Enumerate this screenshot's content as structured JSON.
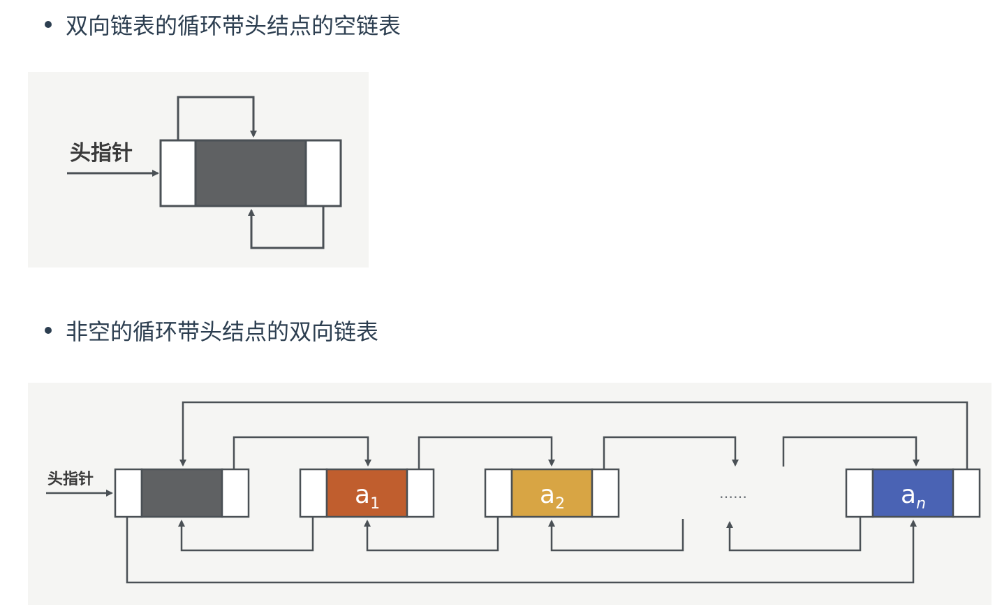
{
  "sections": [
    {
      "heading": "双向链表的循环带头结点的空链表"
    },
    {
      "heading": "非空的循环带头结点的双向链表"
    }
  ],
  "diagram_empty": {
    "head_pointer_label": "头指针"
  },
  "diagram_full": {
    "head_pointer_label": "头指针",
    "nodes": [
      {
        "base": "a",
        "sub": "1",
        "color": "#c05e2e"
      },
      {
        "base": "a",
        "sub": "2",
        "color": "#d8a544"
      },
      {
        "base": "a",
        "sub": "n",
        "color": "#4a63b4"
      }
    ],
    "ellipsis": "……"
  },
  "colors": {
    "text": "#2c3e50",
    "head_node_fill": "#5f6163",
    "line": "#4a5055"
  }
}
